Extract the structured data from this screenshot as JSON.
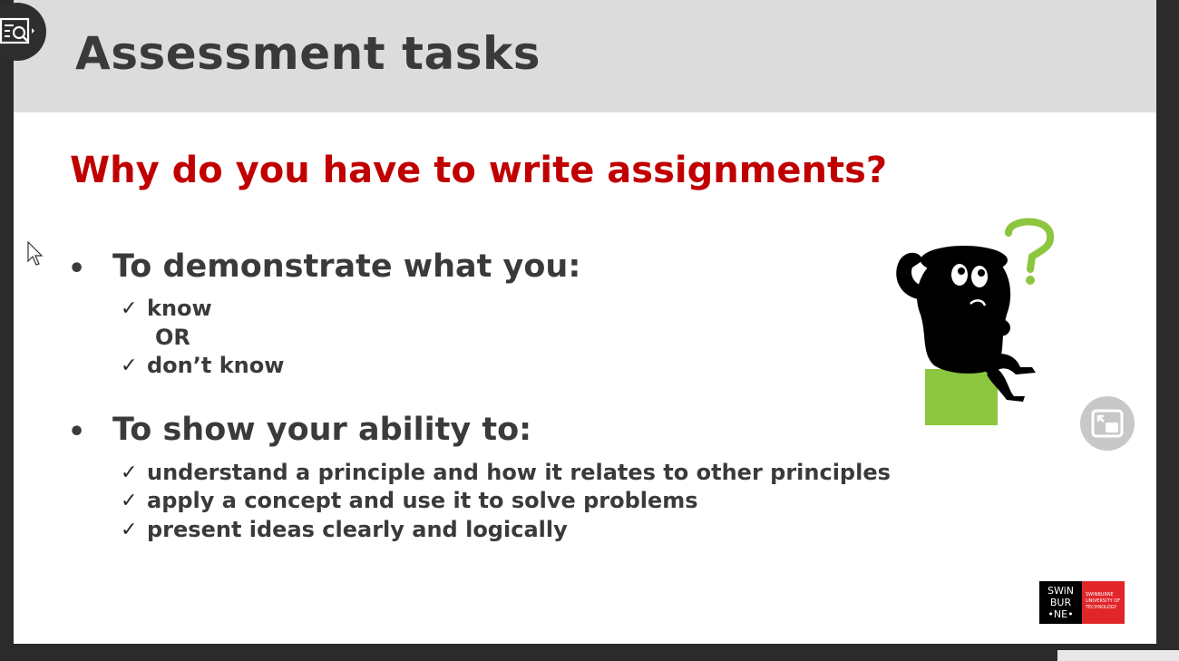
{
  "slide": {
    "title": "Assessment tasks",
    "question": "Why do you have to write assignments?",
    "bullet_mark": "•",
    "check_mark": "✓",
    "bullets": [
      {
        "heading": "To demonstrate what you:",
        "items": [
          "know",
          "don’t know"
        ],
        "separator": "OR"
      },
      {
        "heading": "To show your ability to:",
        "items": [
          "understand a principle and how it relates to other principles",
          "apply a concept and use it to solve problems",
          "present ideas clearly and logically"
        ]
      }
    ]
  },
  "logo": {
    "mark_lines": [
      "SWiN",
      "BUR",
      "•NE•"
    ],
    "sub_lines": [
      "SWINBURNE",
      "UNIVERSITY OF",
      "TECHNOLOGY"
    ]
  },
  "colors": {
    "question_red": "#c00000",
    "title_gray": "#3a3a3a",
    "title_bar": "#dcdcdc",
    "figure_green": "#8cc63f",
    "logo_red": "#e1262a"
  },
  "icons": {
    "viewer_button": "search-list-icon",
    "pip_button": "picture-in-picture-icon",
    "cursor": "mouse-pointer-icon"
  }
}
